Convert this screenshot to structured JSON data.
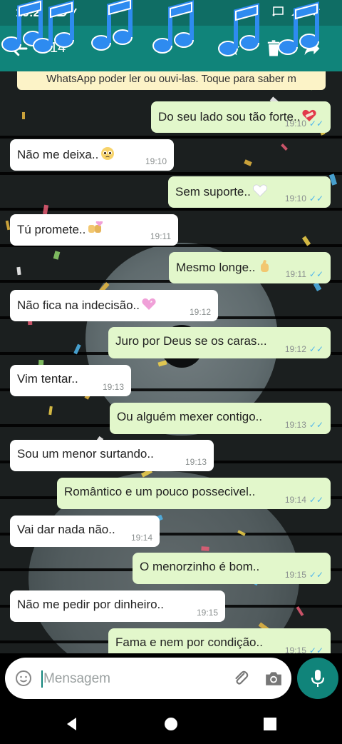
{
  "status_bar": {
    "time": "19:2"
  },
  "toolbar": {
    "selected_count": "14"
  },
  "chat": {
    "banner": "WhatsApp poder ler ou ouvi-las. Toque para saber m",
    "messages": [
      {
        "dir": "out",
        "text": "Do seu lado sou tão forte..",
        "time": "19:10",
        "emoji": "heart-bandage"
      },
      {
        "dir": "in",
        "text": "Não me deixa..",
        "time": "19:10",
        "emoji": "pleading-face"
      },
      {
        "dir": "out",
        "text": "Sem suporte..",
        "time": "19:10",
        "emoji": "white-heart"
      },
      {
        "dir": "in",
        "text": "Tú promete..",
        "time": "19:11",
        "emoji": "pinky-promise"
      },
      {
        "dir": "out",
        "text": "Mesmo longe..",
        "time": "19:11",
        "emoji": "crossed-fingers"
      },
      {
        "dir": "in",
        "text": "Não fica na indecisão..",
        "time": "19:12",
        "emoji": "pink-heart"
      },
      {
        "dir": "out",
        "text": "Juro por Deus se os caras...",
        "time": "19:12",
        "emoji": ""
      },
      {
        "dir": "in",
        "text": "Vim tentar..",
        "time": "19:13",
        "emoji": ""
      },
      {
        "dir": "out",
        "text": "Ou alguém mexer contigo..",
        "time": "19:13",
        "emoji": ""
      },
      {
        "dir": "in",
        "text": "Sou um menor surtando..",
        "time": "19:13",
        "emoji": ""
      },
      {
        "dir": "out",
        "text": "Romântico e um pouco possecivel..",
        "time": "19:14",
        "emoji": ""
      },
      {
        "dir": "in",
        "text": "Vai dar nada não..",
        "time": "19:14",
        "emoji": ""
      },
      {
        "dir": "out",
        "text": "O menorzinho é bom..",
        "time": "19:15",
        "emoji": ""
      },
      {
        "dir": "in",
        "text": "Não me pedir por dinheiro..",
        "time": "19:15",
        "emoji": ""
      },
      {
        "dir": "out",
        "text": "Fama e nem por condição..",
        "time": "19:15",
        "emoji": ""
      }
    ]
  },
  "composer": {
    "placeholder": "Mensagem"
  },
  "colors": {
    "header": "#10847a",
    "status_bar": "#0f6d64",
    "outgoing": "#e2f7cb",
    "incoming": "#ffffff",
    "read_ticks": "#4fb6ec"
  }
}
